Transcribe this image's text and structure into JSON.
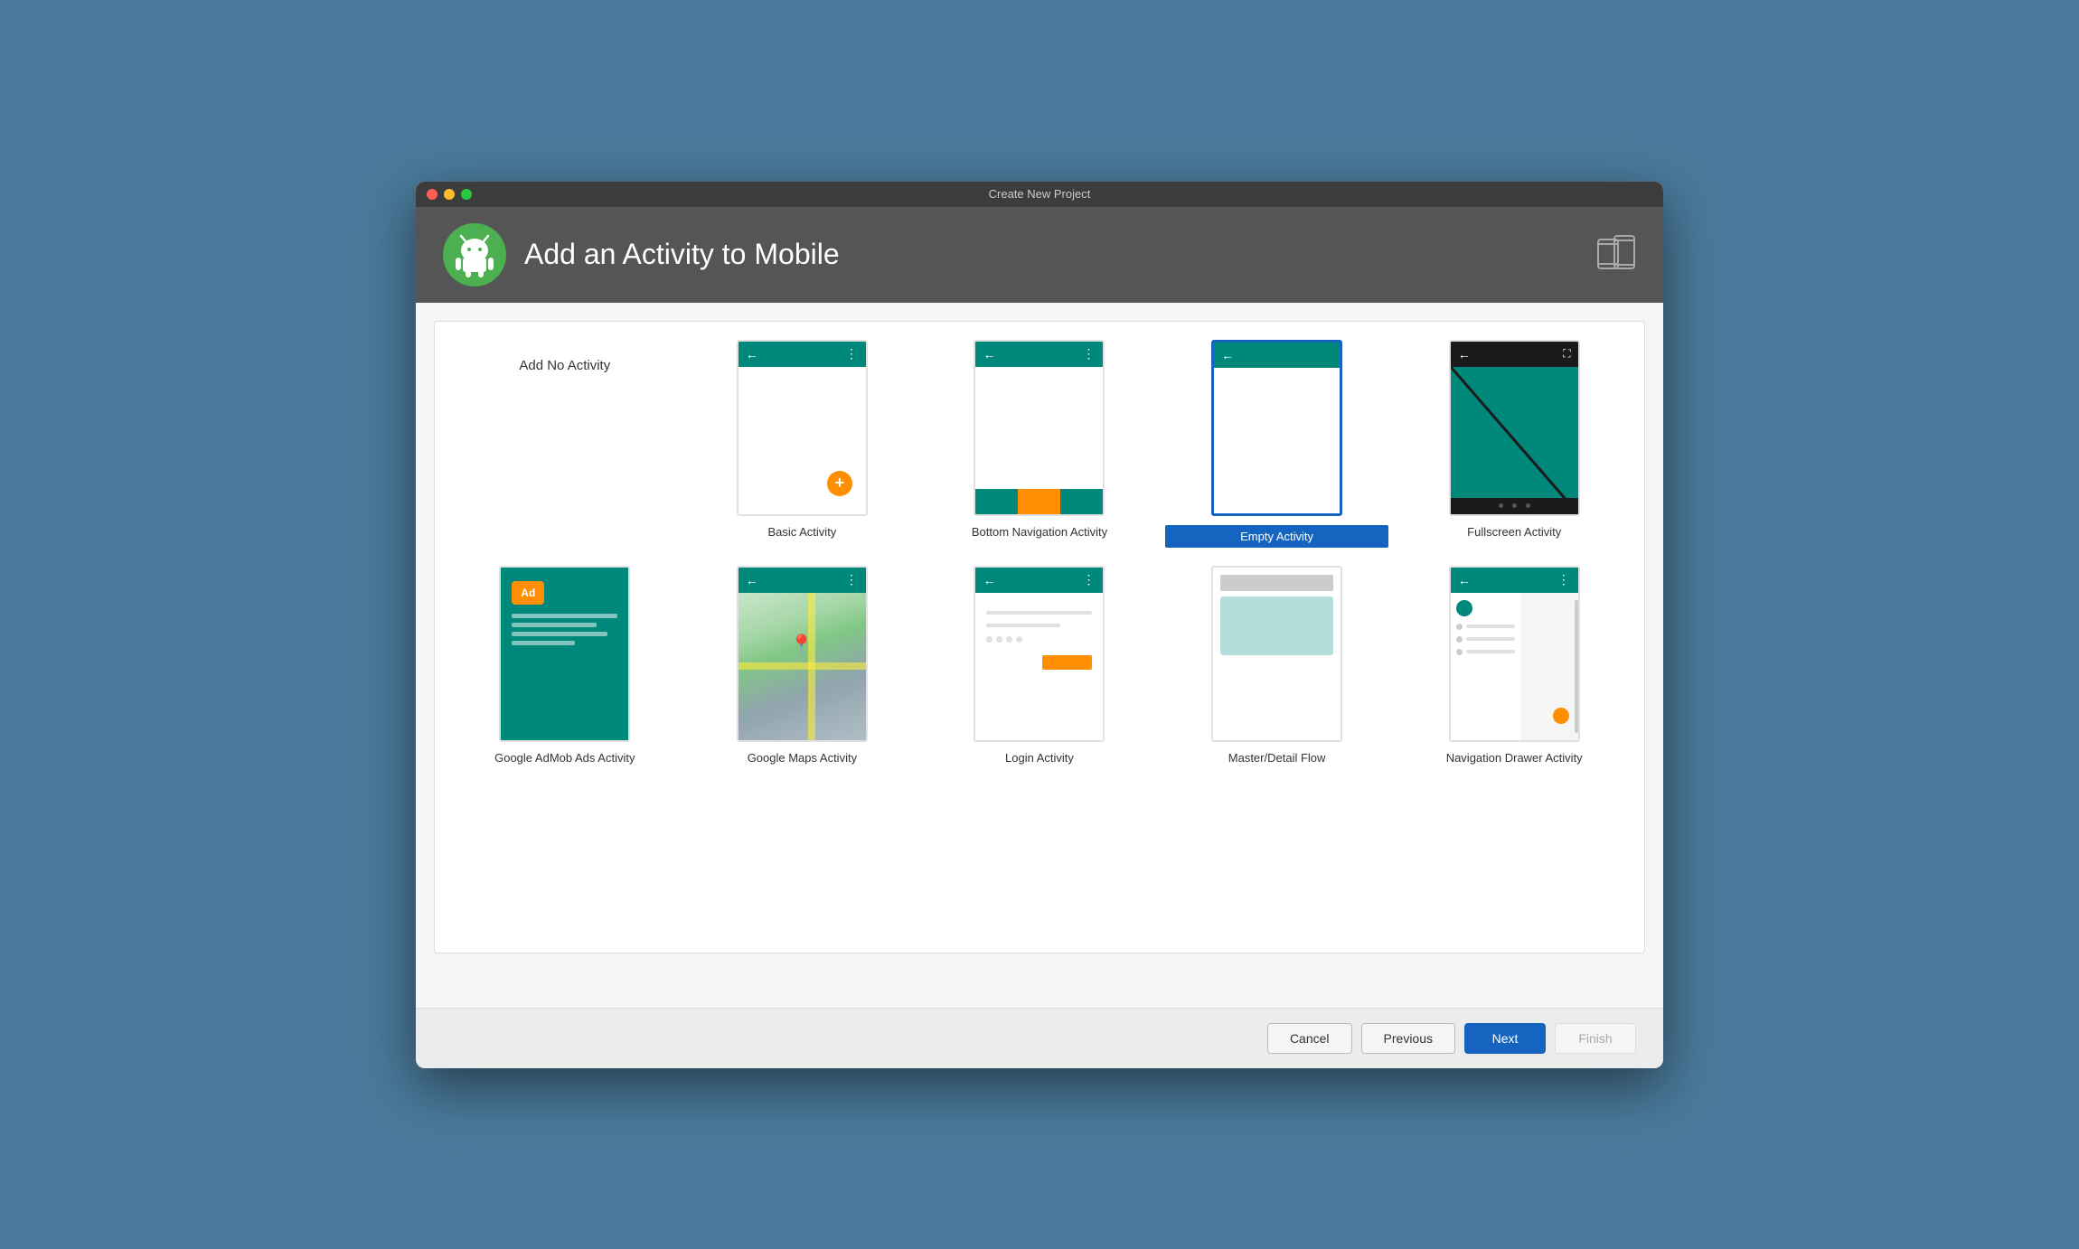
{
  "window": {
    "title": "Create New Project"
  },
  "traffic_lights": {
    "red": "red",
    "yellow": "yellow",
    "green": "green"
  },
  "header": {
    "title": "Add an Activity to Mobile",
    "logo_alt": "Android Studio Logo",
    "device_icon_alt": "Device icon"
  },
  "grid": {
    "items": [
      {
        "id": "no-activity",
        "label": "Add No Activity",
        "selected": false,
        "thumb_type": "none"
      },
      {
        "id": "basic-activity",
        "label": "Basic Activity",
        "selected": false,
        "thumb_type": "basic"
      },
      {
        "id": "bottom-nav-activity",
        "label": "Bottom Navigation Activity",
        "selected": false,
        "thumb_type": "bottomnav"
      },
      {
        "id": "empty-activity",
        "label": "Empty Activity",
        "selected": true,
        "thumb_type": "empty"
      },
      {
        "id": "fullscreen-activity",
        "label": "Fullscreen Activity",
        "selected": false,
        "thumb_type": "fullscreen"
      },
      {
        "id": "admob-activity",
        "label": "Google AdMob Ads Activity",
        "selected": false,
        "thumb_type": "admob"
      },
      {
        "id": "maps-activity",
        "label": "Google Maps Activity",
        "selected": false,
        "thumb_type": "maps"
      },
      {
        "id": "login-activity",
        "label": "Login Activity",
        "selected": false,
        "thumb_type": "login"
      },
      {
        "id": "masterdetail-activity",
        "label": "Master/Detail Flow",
        "selected": false,
        "thumb_type": "masterdetail"
      },
      {
        "id": "navdrawer-activity",
        "label": "Navigation Drawer Activity",
        "selected": false,
        "thumb_type": "navdrawer"
      }
    ]
  },
  "footer": {
    "cancel_label": "Cancel",
    "previous_label": "Previous",
    "next_label": "Next",
    "finish_label": "Finish"
  },
  "colors": {
    "teal": "#00897b",
    "orange": "#ff8f00",
    "blue": "#1565c0",
    "selected_border": "#1565c0"
  }
}
